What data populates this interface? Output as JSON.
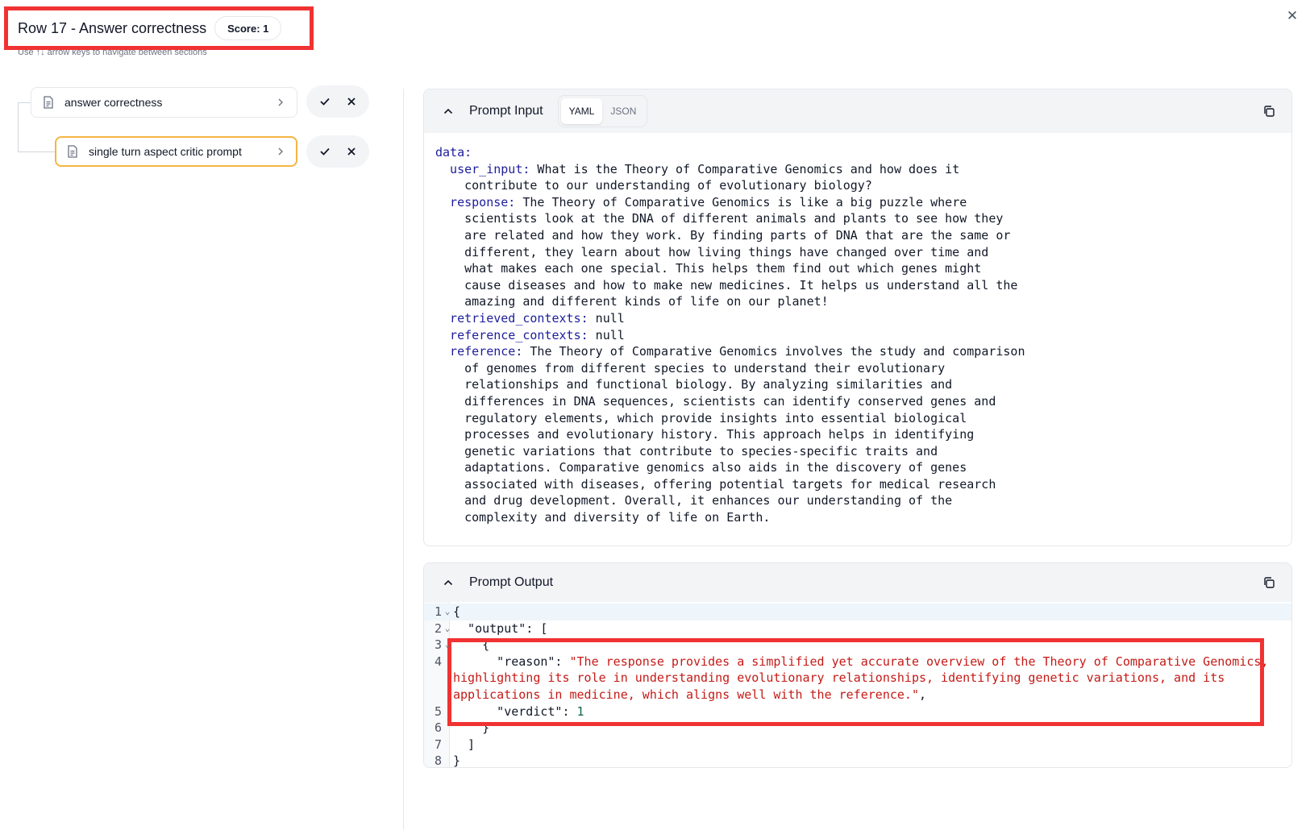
{
  "header": {
    "title": "Row 17 - Answer correctness",
    "score": "Score: 1",
    "hint": "Use ↑↓ arrow keys to navigate between sections"
  },
  "tree": {
    "items": [
      {
        "label": "answer correctness",
        "selected": false
      },
      {
        "label": "single turn aspect critic prompt",
        "selected": true
      }
    ]
  },
  "prompt_input": {
    "title": "Prompt Input",
    "formats": [
      "YAML",
      "JSON"
    ],
    "active_format": "YAML",
    "lines": [
      {
        "key": "data:",
        "text": ""
      },
      {
        "key": "  user_input:",
        "text": " What is the Theory of Comparative Genomics and how does it"
      },
      {
        "key": "",
        "text": "    contribute to our understanding of evolutionary biology?"
      },
      {
        "key": "  response:",
        "text": " The Theory of Comparative Genomics is like a big puzzle where"
      },
      {
        "key": "",
        "text": "    scientists look at the DNA of different animals and plants to see how they"
      },
      {
        "key": "",
        "text": "    are related and how they work. By finding parts of DNA that are the same or"
      },
      {
        "key": "",
        "text": "    different, they learn about how living things have changed over time and"
      },
      {
        "key": "",
        "text": "    what makes each one special. This helps them find out which genes might"
      },
      {
        "key": "",
        "text": "    cause diseases and how to make new medicines. It helps us understand all the"
      },
      {
        "key": "",
        "text": "    amazing and different kinds of life on our planet!"
      },
      {
        "key": "  retrieved_contexts:",
        "text": " null"
      },
      {
        "key": "  reference_contexts:",
        "text": " null"
      },
      {
        "key": "  reference:",
        "text": " The Theory of Comparative Genomics involves the study and comparison"
      },
      {
        "key": "",
        "text": "    of genomes from different species to understand their evolutionary"
      },
      {
        "key": "",
        "text": "    relationships and functional biology. By analyzing similarities and"
      },
      {
        "key": "",
        "text": "    differences in DNA sequences, scientists can identify conserved genes and"
      },
      {
        "key": "",
        "text": "    regulatory elements, which provide insights into essential biological"
      },
      {
        "key": "",
        "text": "    processes and evolutionary history. This approach helps in identifying"
      },
      {
        "key": "",
        "text": "    genetic variations that contribute to species-specific traits and"
      },
      {
        "key": "",
        "text": "    adaptations. Comparative genomics also aids in the discovery of genes"
      },
      {
        "key": "",
        "text": "    associated with diseases, offering potential targets for medical research"
      },
      {
        "key": "",
        "text": "    and drug development. Overall, it enhances our understanding of the"
      },
      {
        "key": "",
        "text": "    complexity and diversity of life on Earth."
      }
    ]
  },
  "prompt_output": {
    "title": "Prompt Output",
    "lines": [
      {
        "num": "1",
        "fold": "⌄",
        "text": "{"
      },
      {
        "num": "2",
        "fold": "⌄",
        "text": "  \"output\": ["
      },
      {
        "num": "3",
        "fold": "⌄",
        "text": "    {"
      },
      {
        "num": "4",
        "fold": "",
        "key": "      \"reason\": ",
        "str": "\"The response provides a simplified yet accurate overview of the Theory of Comparative Genomics,",
        "cont": [
          "highlighting its role in understanding evolutionary relationships, identifying genetic variations, and its",
          "applications in medicine, which aligns well with the reference.\""
        ],
        "tail": ","
      },
      {
        "num": "5",
        "fold": "",
        "key": "      \"verdict\": ",
        "val": "1"
      },
      {
        "num": "6",
        "fold": "",
        "text": "    }"
      },
      {
        "num": "7",
        "fold": "",
        "text": "  ]"
      },
      {
        "num": "8",
        "fold": "",
        "text": "}"
      }
    ]
  },
  "colors": {
    "annotation": "#f03232",
    "selected_border": "#f5b544",
    "yaml_key": "#1d1d9b",
    "json_string": "#c41a16"
  }
}
